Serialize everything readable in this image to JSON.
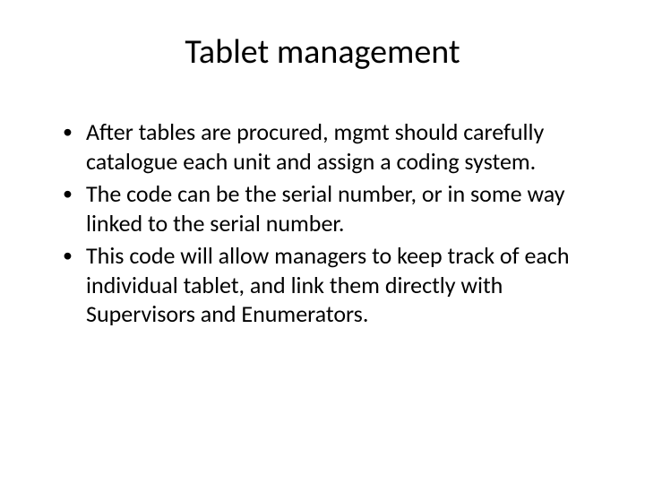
{
  "slide": {
    "title": "Tablet management",
    "bullets": [
      "After tables are procured, mgmt should carefully catalogue each unit and assign a coding system.",
      "The code can be the serial number, or in some way linked to the serial number.",
      "This code will allow managers to keep track of each individual tablet, and link them directly with Supervisors and Enumerators."
    ],
    "bullet_marker": "•"
  }
}
